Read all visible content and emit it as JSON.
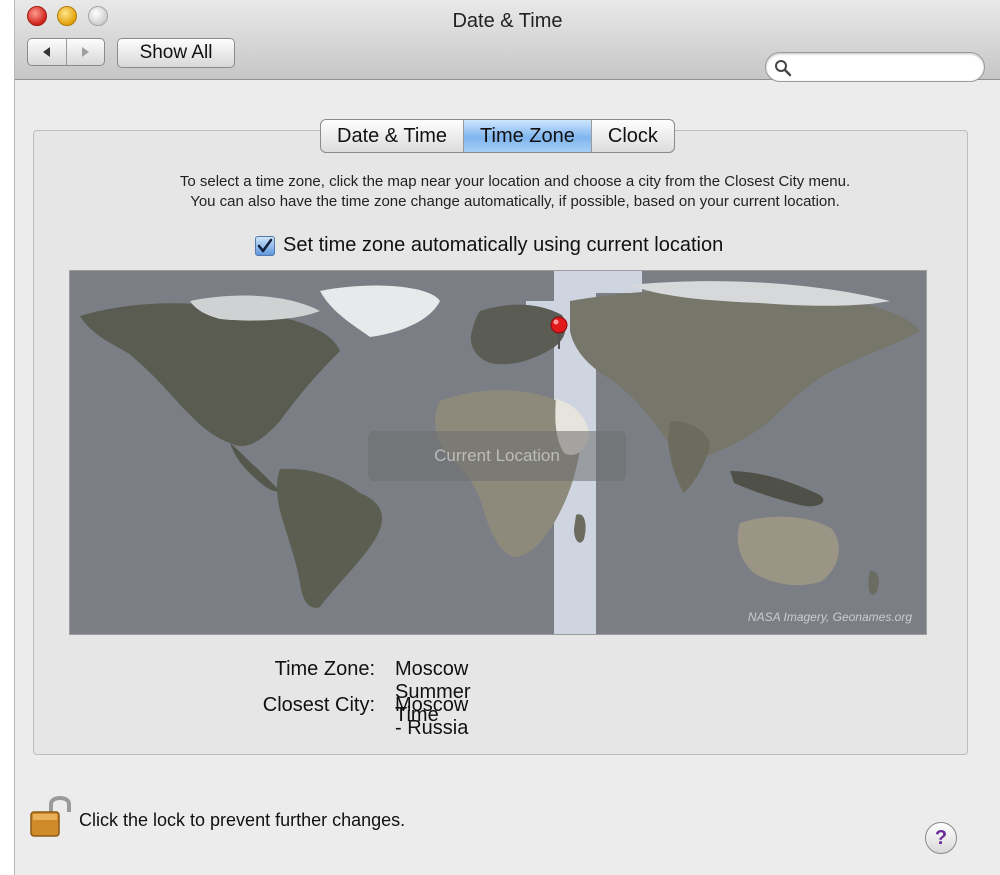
{
  "window": {
    "title": "Date & Time",
    "back_icon": "triangle-left-icon",
    "forward_icon": "triangle-right-icon",
    "show_all_label": "Show All",
    "search_placeholder": ""
  },
  "tabs": [
    {
      "label": "Date & Time",
      "active": false
    },
    {
      "label": "Time Zone",
      "active": true
    },
    {
      "label": "Clock",
      "active": false
    }
  ],
  "instructions": {
    "line1": "To select a time zone, click the map near your location and choose a city from the Closest City menu.",
    "line2": "You can also have the time zone change automatically, if possible, based on your current location."
  },
  "auto_location": {
    "checked": true,
    "label": "Set time zone automatically using current location"
  },
  "map": {
    "credit": "NASA Imagery, Geonames.org",
    "overlay_text": "Current Location",
    "pin_color": "#e0191c",
    "timezone_band_color": "#d9e0ea"
  },
  "info": {
    "time_zone_label": "Time Zone:",
    "time_zone_value": "Moscow Summer Time",
    "closest_city_label": "Closest City:",
    "closest_city_value": "Moscow - Russia"
  },
  "footer": {
    "lock_text": "Click the lock to prevent further changes.",
    "help_label": "?"
  }
}
